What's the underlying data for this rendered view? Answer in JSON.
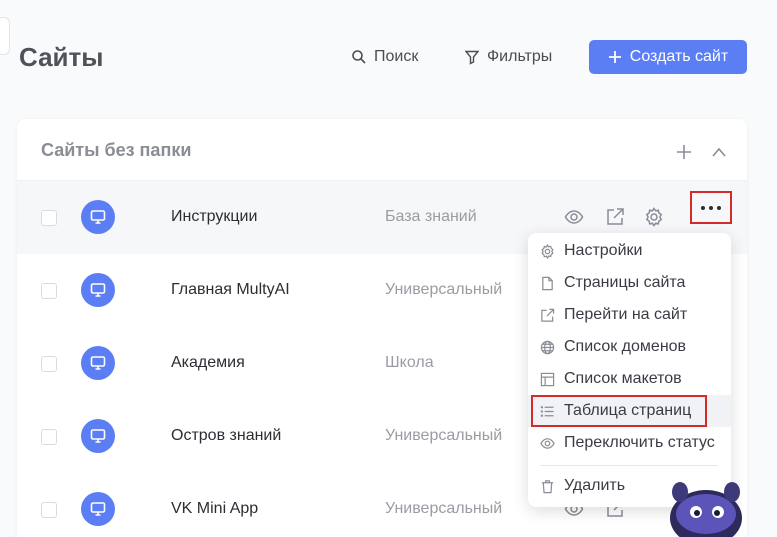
{
  "page": {
    "title": "Сайты"
  },
  "header": {
    "search_label": "Поиск",
    "filter_label": "Фильтры",
    "create_label": "Создать сайт"
  },
  "section": {
    "title": "Сайты без папки"
  },
  "rows": [
    {
      "name": "Инструкции",
      "type": "База знаний"
    },
    {
      "name": "Главная MultyAI",
      "type": "Универсальный"
    },
    {
      "name": "Академия",
      "type": "Школа"
    },
    {
      "name": "Остров знаний",
      "type": "Универсальный"
    },
    {
      "name": "VK Mini App",
      "type": "Универсальный"
    }
  ],
  "menu": {
    "items": [
      {
        "label": "Настройки",
        "icon": "gear-icon"
      },
      {
        "label": "Страницы сайта",
        "icon": "file-icon"
      },
      {
        "label": "Перейти на сайт",
        "icon": "external-link-icon"
      },
      {
        "label": "Список доменов",
        "icon": "globe-icon"
      },
      {
        "label": "Список макетов",
        "icon": "layout-icon"
      },
      {
        "label": "Таблица страниц",
        "icon": "list-icon"
      },
      {
        "label": "Переключить статус",
        "icon": "eye-icon"
      },
      {
        "label": "Удалить",
        "icon": "trash-icon"
      }
    ]
  },
  "colors": {
    "accent": "#5b7ef5",
    "highlight_border": "#d42a2a"
  }
}
